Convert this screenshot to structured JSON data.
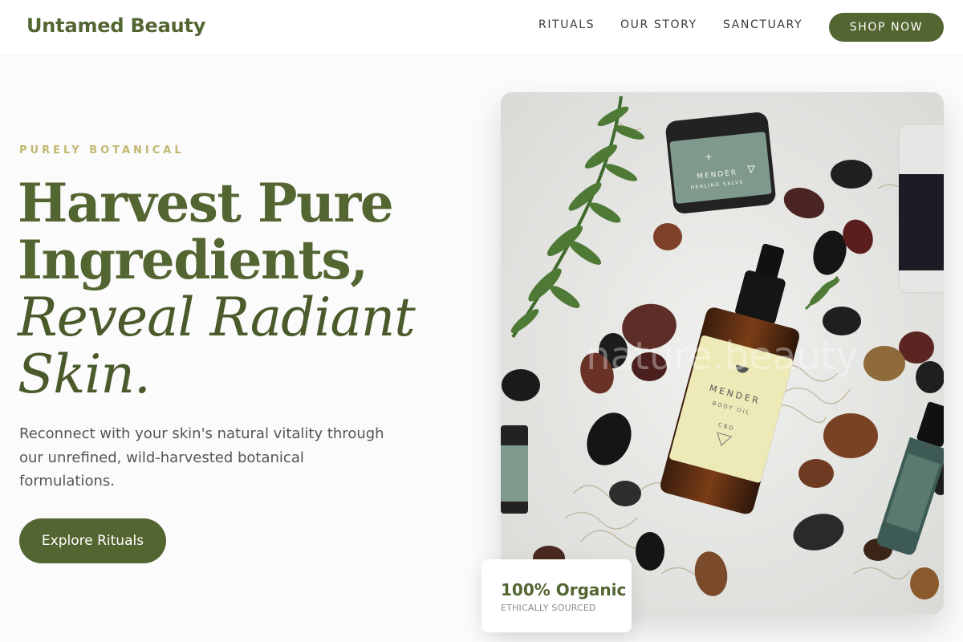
{
  "header": {
    "brand": "Untamed Beauty",
    "nav": [
      {
        "label": "RITUALS"
      },
      {
        "label": "OUR STORY"
      },
      {
        "label": "SANCTUARY"
      }
    ],
    "cta_label": "SHOP NOW"
  },
  "hero": {
    "eyebrow": "PURELY BOTANICAL",
    "headline_line1": "Harvest Pure",
    "headline_line2": "Ingredients,",
    "headline_italic1": "Reveal Radiant",
    "headline_italic2": "Skin.",
    "lead": "Reconnect with your skin's natural vitality through our unrefined, wild-harvested botanical formulations.",
    "cta_label": "Explore Rituals"
  },
  "product_image": {
    "jar_top_brand": "MENDER",
    "jar_top_product": "HEALING SALVE",
    "bottle_brand": "MENDER",
    "bottle_product": "BODY OIL",
    "bottle_variant": "CBD",
    "watermark": "nature.beauty"
  },
  "badge": {
    "title": "100% Organic",
    "subtitle": "ETHICALLY SOURCED"
  },
  "colors": {
    "brand_green": "#536531",
    "accent_gold": "#c2b770",
    "label_sage": "#7f9a8c",
    "label_cream": "#eeeab8"
  },
  "icons": [
    "plus-icon",
    "triangle-icon",
    "crescent-icon"
  ]
}
